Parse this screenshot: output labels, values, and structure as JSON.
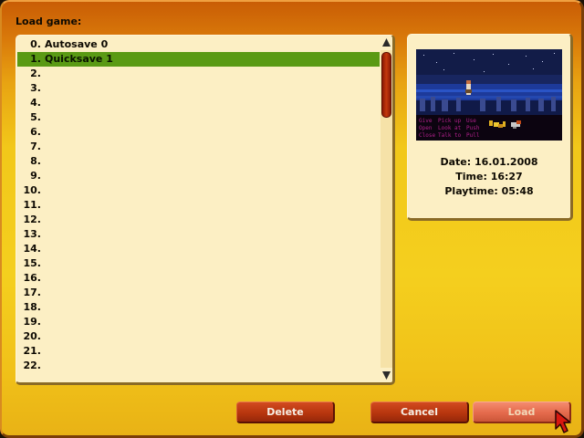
{
  "dialog": {
    "title": "Load game:"
  },
  "saves": [
    {
      "num": "0.",
      "name": "Autosave 0"
    },
    {
      "num": "1.",
      "name": "Quicksave 1",
      "selected": true
    },
    {
      "num": "2.",
      "name": ""
    },
    {
      "num": "3.",
      "name": ""
    },
    {
      "num": "4.",
      "name": ""
    },
    {
      "num": "5.",
      "name": ""
    },
    {
      "num": "6.",
      "name": ""
    },
    {
      "num": "7.",
      "name": ""
    },
    {
      "num": "8.",
      "name": ""
    },
    {
      "num": "9.",
      "name": ""
    },
    {
      "num": "10.",
      "name": ""
    },
    {
      "num": "11.",
      "name": ""
    },
    {
      "num": "12.",
      "name": ""
    },
    {
      "num": "13.",
      "name": ""
    },
    {
      "num": "14.",
      "name": ""
    },
    {
      "num": "15.",
      "name": ""
    },
    {
      "num": "16.",
      "name": ""
    },
    {
      "num": "17.",
      "name": ""
    },
    {
      "num": "18.",
      "name": ""
    },
    {
      "num": "19.",
      "name": ""
    },
    {
      "num": "20.",
      "name": ""
    },
    {
      "num": "21.",
      "name": ""
    },
    {
      "num": "22.",
      "name": ""
    }
  ],
  "scrollbar": {
    "up_icon": "triangle-up-icon",
    "down_icon": "triangle-down-icon"
  },
  "preview": {
    "date": "Date: 16.01.2008",
    "time": "Time: 16:27",
    "playtime": "Playtime: 05:48",
    "verbs": [
      "Give",
      "Pick up",
      "Use",
      "Open",
      "Look at",
      "Push",
      "Close",
      "Talk to",
      "Pull"
    ]
  },
  "buttons": {
    "delete": "Delete",
    "cancel": "Cancel",
    "load": "Load"
  },
  "colors": {
    "selection": "#5a9a14",
    "button": "#b8360e",
    "button_disabled": "#e46a4c",
    "panel": "#fcefc4"
  },
  "cursor": {
    "icon": "mouse-pointer-icon"
  }
}
